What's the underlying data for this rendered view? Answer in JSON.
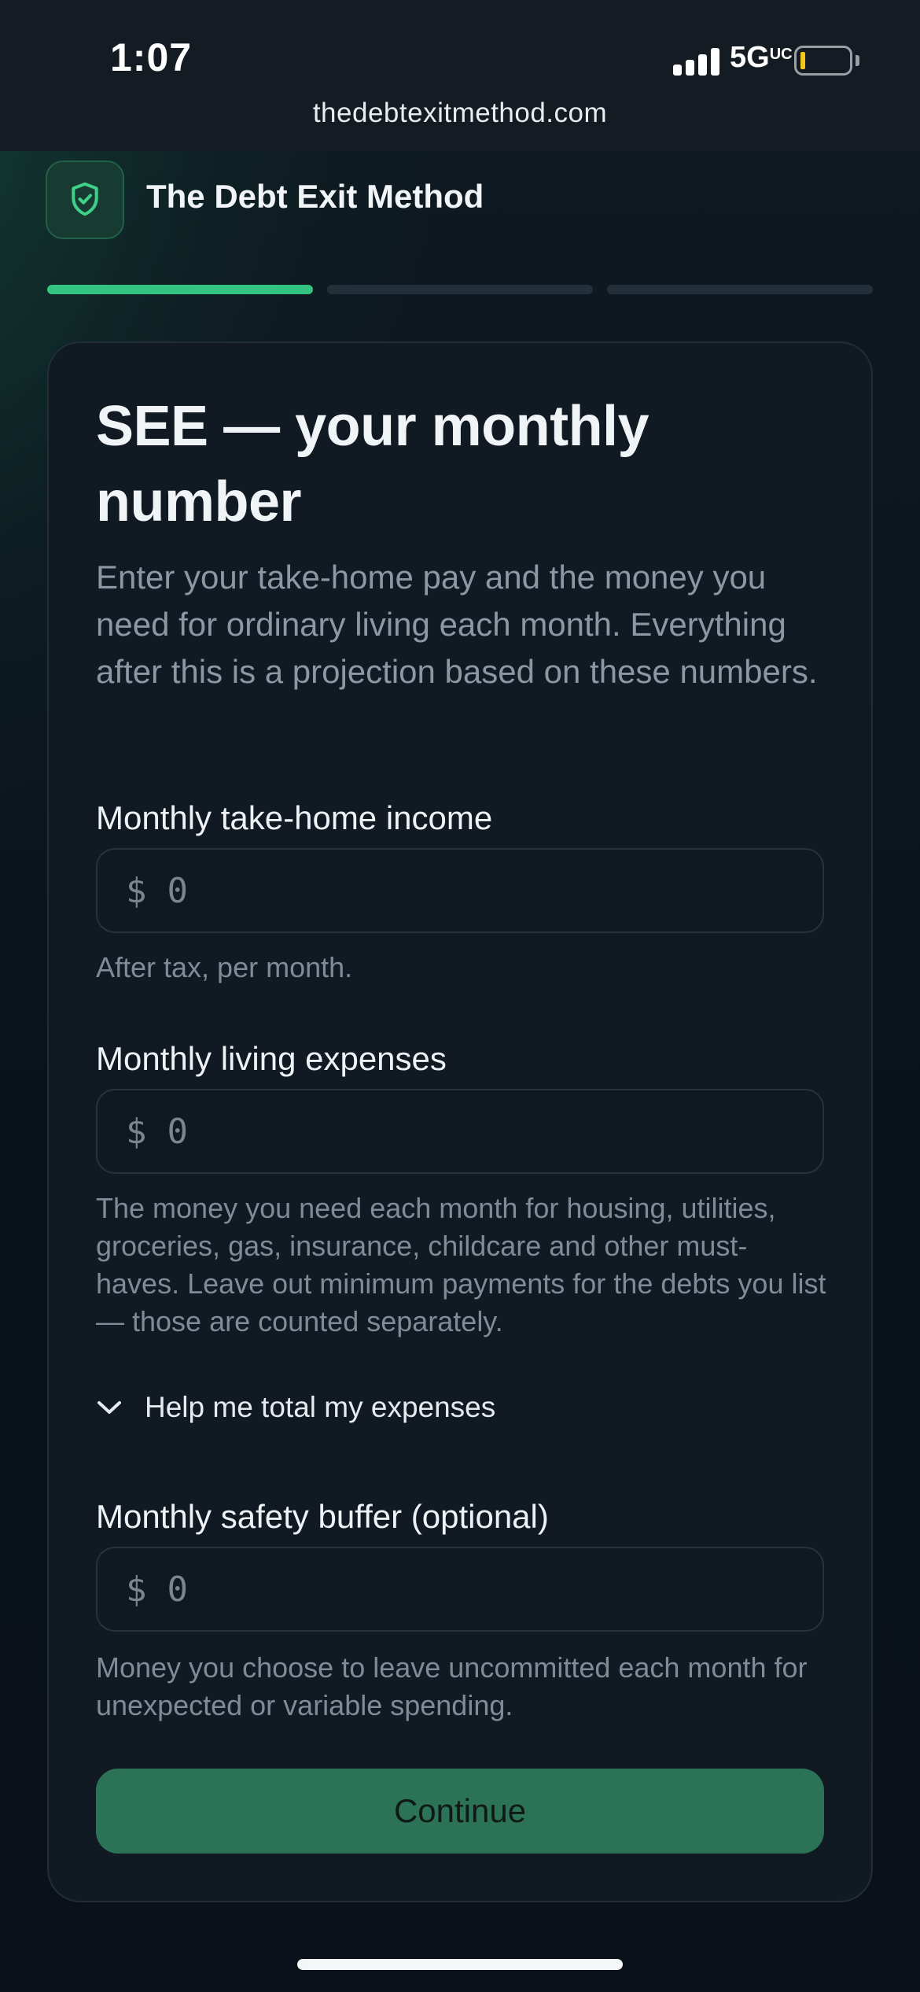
{
  "status_bar": {
    "time": "1:07",
    "network": "5G",
    "url": "thedebtexitmethod.com"
  },
  "header": {
    "brand": "The Debt Exit Method",
    "logo_icon": "shield-check-icon",
    "accent_color": "#33c47f"
  },
  "progress": {
    "total_steps": 3,
    "current_step": 1
  },
  "form": {
    "title": "SEE — your monthly number",
    "intro": "Enter your take-home pay and the money you need for ordinary living each month. Everything after this is a projection based on these numbers.",
    "currency_symbol": "$",
    "income": {
      "label": "Monthly take-home income",
      "placeholder": "0",
      "help": "After tax, per month."
    },
    "expenses": {
      "label": "Monthly living expenses",
      "placeholder": "0",
      "help": "The money you need each month for housing, utilities, groceries, gas, insurance, childcare and other must-haves. Leave out minimum payments for the debts you list — those are counted separately."
    },
    "expenses_helper_toggle": "Help me total my expenses",
    "buffer": {
      "label": "Monthly safety buffer (optional)",
      "placeholder": "0",
      "help": "Money you choose to leave uncommitted each month for unexpected or variable spending."
    },
    "continue_label": "Continue"
  }
}
